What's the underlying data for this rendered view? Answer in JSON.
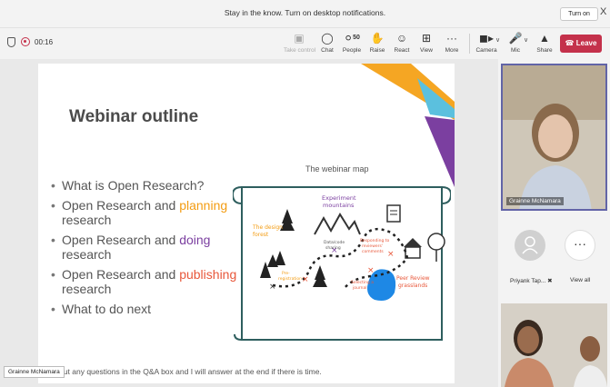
{
  "notification": {
    "message": "Stay in the know. Turn on desktop notifications.",
    "turn_on_label": "Turn on",
    "close_label": "X"
  },
  "meeting": {
    "timer": "00:16"
  },
  "toolbar": {
    "take_control": "Take control",
    "chat": "Chat",
    "people": "People",
    "people_count": "50",
    "raise": "Raise",
    "react": "React",
    "view": "View",
    "more": "More",
    "camera": "Camera",
    "mic": "Mic",
    "share": "Share",
    "leave": "Leave"
  },
  "slide": {
    "title": "Webinar outline",
    "bullets": {
      "b1": "What is Open Research?",
      "b2_prefix": "Open Research and ",
      "b2_highlight": "planning",
      "b2_suffix": "research",
      "b3_prefix": "Open Research and ",
      "b3_highlight": "doing",
      "b3_suffix": "research",
      "b4_prefix": "Open Research and ",
      "b4_highlight": "publishing",
      "b4_suffix": "research",
      "b5": "What to do next"
    },
    "map_title": "The webinar map",
    "map": {
      "experiment_1": "Experiment",
      "experiment_2": "mountains",
      "data_1": "Data/code",
      "data_2": "sharing",
      "forest_1": "The design",
      "forest_2": "forest",
      "pre_1": "Pre-",
      "pre_2": "registration",
      "responding_1": "Responding to",
      "responding_2": "reviewers'",
      "responding_3": "comments",
      "selecting_1": "Selecting a",
      "selecting_2": "journal",
      "peer_1": "Peer Review",
      "peer_2": "grasslands"
    },
    "footer": "e put any questions in the Q&A box and I will answer at the end if there is time.",
    "colors": {
      "planning": "#f39c12",
      "doing": "#7b3fa0",
      "publishing": "#e8573a",
      "scroll": "#2e5e5e",
      "lake": "#1e88e5"
    }
  },
  "presenter_tag": "Grainne McNamara",
  "participants": {
    "main_name": "Grainne McNamara",
    "tile_1": "Priyank Tap...",
    "tile_2": "View all"
  }
}
